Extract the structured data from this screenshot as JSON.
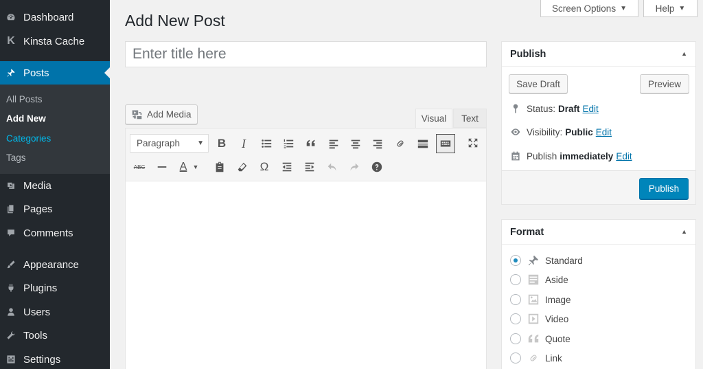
{
  "sidebar": {
    "items": [
      {
        "label": "Dashboard",
        "icon": "dashboard-icon"
      },
      {
        "label": "Kinsta Cache",
        "icon": "kinsta-icon"
      },
      {
        "label": "Posts",
        "icon": "pin-icon"
      },
      {
        "label": "Media",
        "icon": "media-icon"
      },
      {
        "label": "Pages",
        "icon": "pages-icon"
      },
      {
        "label": "Comments",
        "icon": "comments-icon"
      },
      {
        "label": "Appearance",
        "icon": "appearance-icon"
      },
      {
        "label": "Plugins",
        "icon": "plugins-icon"
      },
      {
        "label": "Users",
        "icon": "users-icon"
      },
      {
        "label": "Tools",
        "icon": "tools-icon"
      },
      {
        "label": "Settings",
        "icon": "settings-icon"
      }
    ],
    "submenu": [
      "All Posts",
      "Add New",
      "Categories",
      "Tags"
    ],
    "kinsta_glyph": "K"
  },
  "header": {
    "title": "Add New Post",
    "screen_options": "Screen Options",
    "help": "Help",
    "arrow": "▼"
  },
  "title_field": {
    "placeholder": "Enter title here"
  },
  "editor": {
    "add_media": "Add Media",
    "tab_visual": "Visual",
    "tab_text": "Text",
    "format_select": "Paragraph",
    "format_caret": "▼",
    "b": "B",
    "i": "I",
    "abc": "ABC",
    "text_color": "A",
    "omega": "Ω",
    "color_caret": "▼"
  },
  "publish_box": {
    "title": "Publish",
    "toggle": "▲",
    "save_draft": "Save Draft",
    "preview": "Preview",
    "status_label": "Status:",
    "status_value": "Draft",
    "visibility_label": "Visibility:",
    "visibility_value": "Public",
    "publish_label": "Publish",
    "publish_value": "immediately",
    "edit": "Edit",
    "publish_button": "Publish"
  },
  "format_box": {
    "title": "Format",
    "toggle": "▲",
    "options": [
      "Standard",
      "Aside",
      "Image",
      "Video",
      "Quote",
      "Link"
    ],
    "selected": "Standard"
  },
  "colors": {
    "sidebar": "#23282d",
    "accent": "#0073aa",
    "button_primary": "#0085ba"
  }
}
